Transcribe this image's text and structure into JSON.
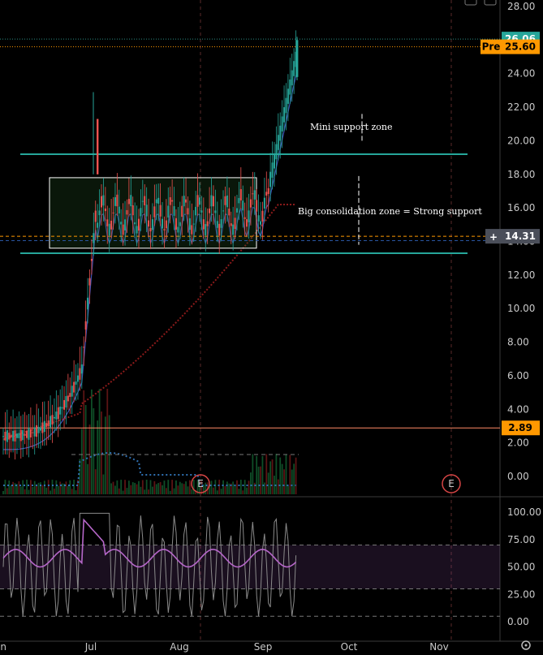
{
  "chart_data": {
    "type": "candlestick",
    "price_axis": {
      "ticks": [
        "28.00",
        "26.00",
        "24.00",
        "22.00",
        "20.00",
        "18.00",
        "16.00",
        "14.00",
        "12.00",
        "10.00",
        "8.00",
        "6.00",
        "4.00",
        "2.00",
        "0.00"
      ],
      "range": [
        -1.2,
        28.6
      ]
    },
    "time_axis": {
      "labels": [
        "Jun",
        "Jul",
        "Aug",
        "Sep",
        "Oct",
        "Nov"
      ],
      "range": [
        0,
        669
      ]
    },
    "price_tags": [
      {
        "id": "last",
        "text": "26.06",
        "value": 26.06,
        "color": "#26a69a",
        "text_color": "#ffffff"
      },
      {
        "id": "pre",
        "prefix": "Pre",
        "text": "25.60",
        "value": 25.6,
        "color": "#ff9800",
        "text_color": "#000000"
      },
      {
        "id": "crosshair",
        "text": "14.31",
        "value": 14.31,
        "color": "#4a4e59",
        "text_color": "#ffffff"
      },
      {
        "id": "alert",
        "text": "2.89",
        "value": 2.89,
        "color": "#ff9800",
        "text_color": "#000000"
      }
    ],
    "annotations": [
      {
        "text": "Mini support zone",
        "price": 20.8
      },
      {
        "text": "Big consolidation zone = Strong support",
        "price": 16.0
      }
    ],
    "support_lines": [
      19.2,
      13.3
    ],
    "consolidation_box": {
      "top": 17.8,
      "bottom": 13.6
    },
    "earnings_markers": [
      "E",
      "E"
    ],
    "rsi": {
      "ticks": [
        "100.00",
        "75.00",
        "50.00",
        "25.00",
        "0.00"
      ],
      "levels": [
        70,
        30,
        5
      ],
      "range": [
        -3,
        103
      ]
    },
    "colors": {
      "up": "#26a69a",
      "down": "#ef5350",
      "sma_fast": "#3f51b5",
      "sma_slow": "#8b1a1a",
      "support": "#26a69a",
      "rsi": "#b667c9",
      "rsi_raw": "#8a8a8a"
    }
  }
}
